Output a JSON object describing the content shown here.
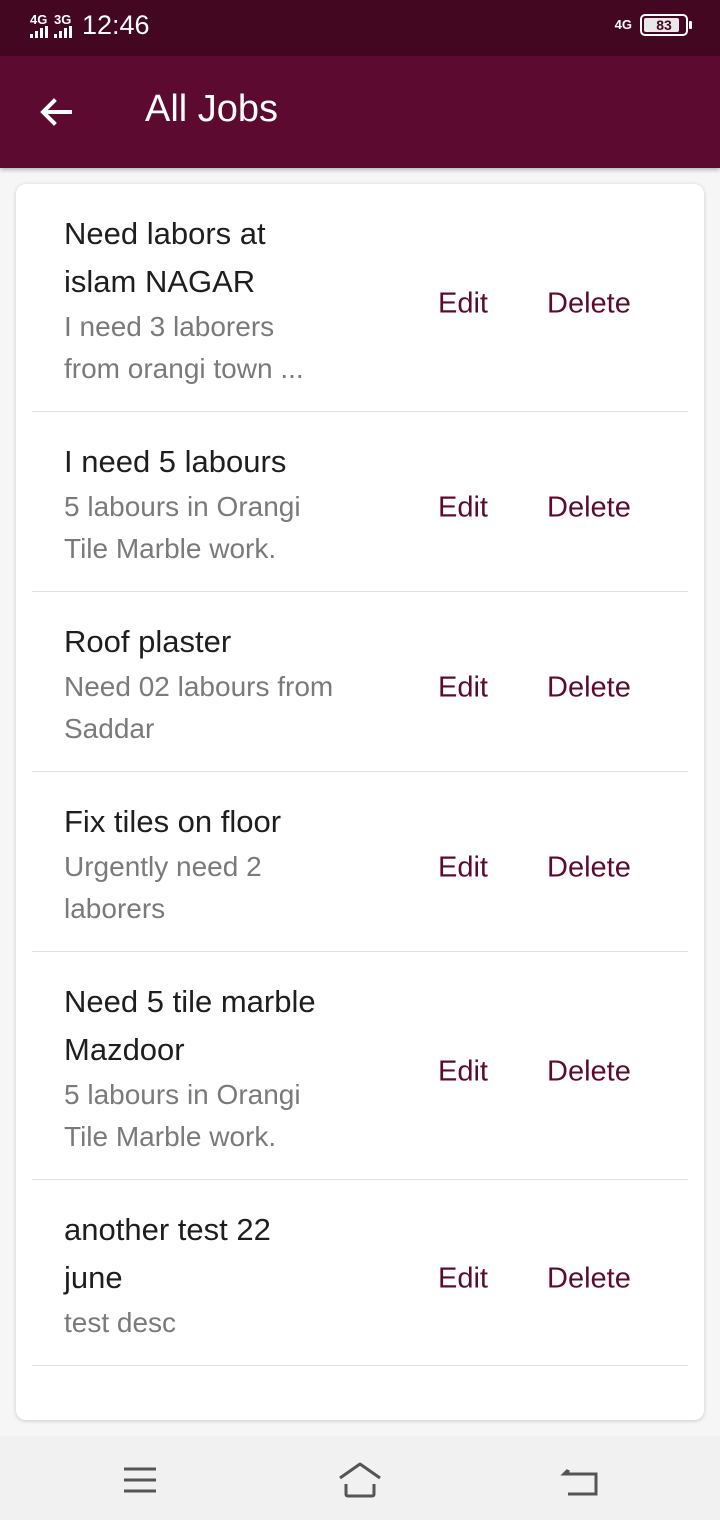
{
  "status_bar": {
    "net1": "4G",
    "net2": "3G",
    "time": "12:46",
    "net_right": "4G",
    "battery": "83"
  },
  "app_bar": {
    "back_icon": "arrow-left-icon",
    "title": "All Jobs"
  },
  "jobs": [
    {
      "title_lines": [
        "Need labors at",
        "islam NAGAR"
      ],
      "desc_lines": [
        "I need 3 laborers",
        "from orangi town ..."
      ]
    },
    {
      "title_lines": [
        "I need 5 labours"
      ],
      "desc_lines": [
        "5 labours in Orangi",
        "Tile Marble work."
      ]
    },
    {
      "title_lines": [
        "Roof plaster"
      ],
      "desc_lines": [
        "Need 02 labours from",
        "Saddar"
      ]
    },
    {
      "title_lines": [
        "Fix tiles on floor"
      ],
      "desc_lines": [
        "Urgently need 2",
        "laborers"
      ]
    },
    {
      "title_lines": [
        "Need 5 tile marble",
        "Mazdoor"
      ],
      "desc_lines": [
        "5 labours in Orangi",
        "Tile Marble work."
      ]
    },
    {
      "title_lines": [
        "another test 22",
        "june"
      ],
      "desc_lines": [
        "test desc"
      ]
    }
  ],
  "actions": {
    "edit_label": "Edit",
    "delete_label": "Delete"
  },
  "colors": {
    "status_bar": "#440722",
    "app_bar": "#5d0a31",
    "accent": "#5d0a31"
  },
  "nav_bar": {
    "menu_icon": "menu-icon",
    "home_icon": "home-icon",
    "back_icon": "back-nav-icon"
  }
}
